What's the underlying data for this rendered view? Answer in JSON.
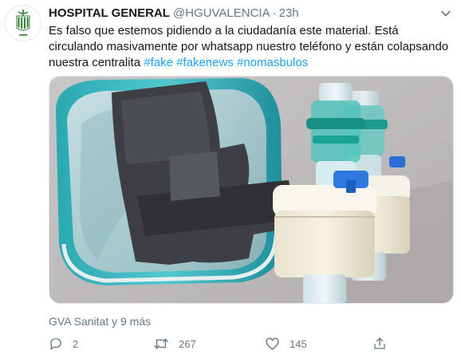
{
  "tweet": {
    "author_name": "HOSPITAL GENERAL",
    "handle": "@HGUVALENCIA",
    "separator": "·",
    "time": "23h",
    "text_parts": {
      "body": "Es falso que estemos pidiendo a la ciudadanía este material. Está circulando masivamente por whatsapp nuestro teléfono y están colapsando nuestra centralita ",
      "tag1": "#fake",
      "tag2": "#fakenews",
      "tag3": "#nomasbulos"
    },
    "liked_by": "GVA Sanitat y 9 más",
    "counts": {
      "reply": "2",
      "retweet": "267",
      "like": "145"
    }
  },
  "icons": {
    "avatar": "hospital-logo-icon",
    "menu": "chevron-down-icon",
    "reply": "reply-icon",
    "retweet": "retweet-icon",
    "like": "heart-icon",
    "share": "share-icon"
  },
  "colors": {
    "text": "#14171a",
    "secondary": "#657786",
    "link": "#1da1f2",
    "logo": "#2e7d32"
  }
}
